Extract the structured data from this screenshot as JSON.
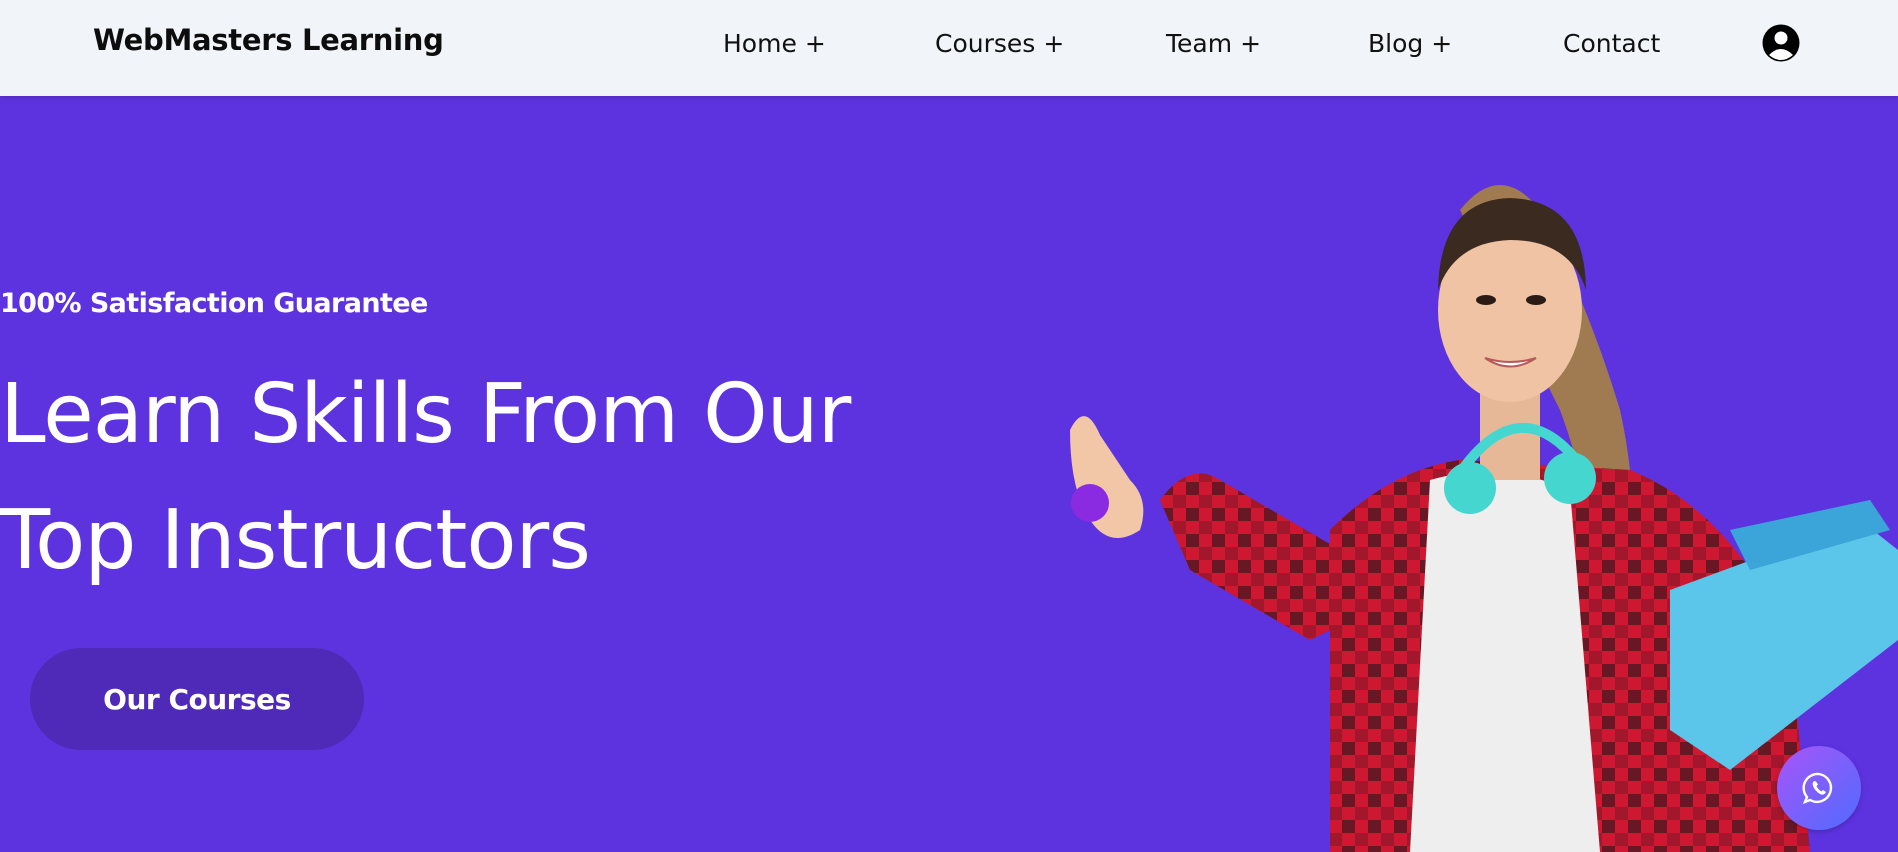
{
  "brand": {
    "name": "WebMasters Learning"
  },
  "nav": {
    "items": [
      {
        "label": "Home",
        "suffix": "+"
      },
      {
        "label": "Courses",
        "suffix": "+"
      },
      {
        "label": "Team",
        "suffix": "+"
      },
      {
        "label": "Blog",
        "suffix": "+"
      },
      {
        "label": "Contact"
      }
    ],
    "account_icon": "user-circle-icon"
  },
  "hero": {
    "tagline": "100% Satisfaction Guarantee",
    "headline": "Learn Skills From Our Top Instructors",
    "cta_label": "Our Courses",
    "background_color": "#5d33e0"
  },
  "floating": {
    "whatsapp_icon": "whatsapp-icon"
  }
}
